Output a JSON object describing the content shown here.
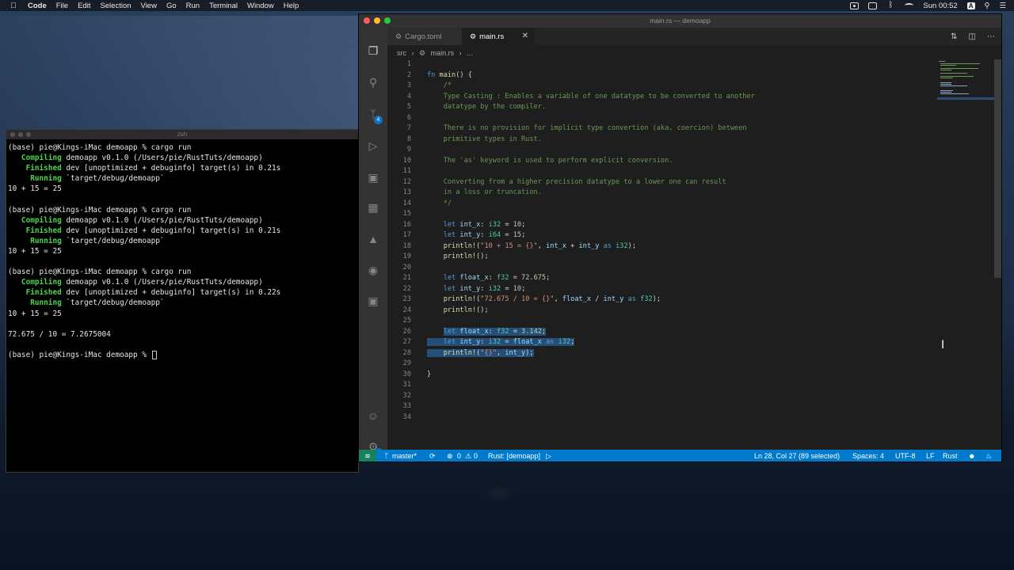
{
  "menubar": {
    "app_name": "Code",
    "items": [
      "File",
      "Edit",
      "Selection",
      "View",
      "Go",
      "Run",
      "Terminal",
      "Window",
      "Help"
    ],
    "clock": "Sun 00:52",
    "input_source": "A"
  },
  "terminal": {
    "title": "zsh",
    "lines": [
      [
        {
          "t": "(base) pie@Kings-iMac demoapp % cargo run"
        }
      ],
      [
        {
          "t": "   Compiling",
          "c": "g"
        },
        {
          "t": " demoapp v0.1.0 (/Users/pie/RustTuts/demoapp)"
        }
      ],
      [
        {
          "t": "    Finished",
          "c": "g"
        },
        {
          "t": " dev [unoptimized + debuginfo] target(s) in 0.21s"
        }
      ],
      [
        {
          "t": "     Running",
          "c": "g"
        },
        {
          "t": " `target/debug/demoapp`"
        }
      ],
      [
        {
          "t": "10 + 15 = 25"
        }
      ],
      [
        {
          "t": ""
        }
      ],
      [
        {
          "t": "(base) pie@Kings-iMac demoapp % cargo run"
        }
      ],
      [
        {
          "t": "   Compiling",
          "c": "g"
        },
        {
          "t": " demoapp v0.1.0 (/Users/pie/RustTuts/demoapp)"
        }
      ],
      [
        {
          "t": "    Finished",
          "c": "g"
        },
        {
          "t": " dev [unoptimized + debuginfo] target(s) in 0.21s"
        }
      ],
      [
        {
          "t": "     Running",
          "c": "g"
        },
        {
          "t": " `target/debug/demoapp`"
        }
      ],
      [
        {
          "t": "10 + 15 = 25"
        }
      ],
      [
        {
          "t": ""
        }
      ],
      [
        {
          "t": "(base) pie@Kings-iMac demoapp % cargo run"
        }
      ],
      [
        {
          "t": "   Compiling",
          "c": "g"
        },
        {
          "t": " demoapp v0.1.0 (/Users/pie/RustTuts/demoapp)"
        }
      ],
      [
        {
          "t": "    Finished",
          "c": "g"
        },
        {
          "t": " dev [unoptimized + debuginfo] target(s) in 0.22s"
        }
      ],
      [
        {
          "t": "     Running",
          "c": "g"
        },
        {
          "t": " `target/debug/demoapp`"
        }
      ],
      [
        {
          "t": "10 + 15 = 25"
        }
      ],
      [
        {
          "t": ""
        }
      ],
      [
        {
          "t": "72.675 / 10 = 7.2675004"
        }
      ],
      [
        {
          "t": ""
        }
      ],
      [
        {
          "t": "(base) pie@Kings-iMac demoapp % "
        }
      ]
    ]
  },
  "vscode": {
    "window_title": "main.rs — demoapp",
    "tabs": [
      {
        "label": "Cargo.toml",
        "active": false
      },
      {
        "label": "main.rs",
        "active": true
      }
    ],
    "breadcrumb": [
      "src",
      "main.rs",
      "..."
    ],
    "activity_badges": {
      "source_control": "4",
      "settings": "1"
    },
    "code_lines": [
      [],
      [
        {
          "t": "fn ",
          "c": "kw"
        },
        {
          "t": "main",
          "c": "fn"
        },
        {
          "t": "() {"
        }
      ],
      [
        {
          "t": "    "
        },
        {
          "t": "/*",
          "c": "cm"
        }
      ],
      [
        {
          "t": "    Type Casting : Enables a variable of one datatype to be converted to another",
          "c": "cm"
        }
      ],
      [
        {
          "t": "    datatype by the compiler.",
          "c": "cm"
        }
      ],
      [],
      [
        {
          "t": "    There is no provision for implicit type convertion (aka, coercion) between",
          "c": "cm"
        }
      ],
      [
        {
          "t": "    primitive types in Rust.",
          "c": "cm"
        }
      ],
      [],
      [
        {
          "t": "    The 'as' keyword is used to perform explicit conversion.",
          "c": "cm"
        }
      ],
      [],
      [
        {
          "t": "    Converting from a higher precision datatype to a lower one can result",
          "c": "cm"
        }
      ],
      [
        {
          "t": "    in a loss or truncation.",
          "c": "cm"
        }
      ],
      [
        {
          "t": "    */",
          "c": "cm"
        }
      ],
      [],
      [
        {
          "t": "    "
        },
        {
          "t": "let ",
          "c": "kw"
        },
        {
          "t": "int_x",
          "c": "var"
        },
        {
          "t": ": "
        },
        {
          "t": "i32",
          "c": "ty"
        },
        {
          "t": " = "
        },
        {
          "t": "10",
          "c": "num"
        },
        {
          "t": ";"
        }
      ],
      [
        {
          "t": "    "
        },
        {
          "t": "let ",
          "c": "kw"
        },
        {
          "t": "int_y",
          "c": "var"
        },
        {
          "t": ": "
        },
        {
          "t": "i64",
          "c": "ty"
        },
        {
          "t": " = "
        },
        {
          "t": "15",
          "c": "num"
        },
        {
          "t": ";"
        }
      ],
      [
        {
          "t": "    "
        },
        {
          "t": "println!",
          "c": "mac"
        },
        {
          "t": "("
        },
        {
          "t": "\"10 + 15 = {}\"",
          "c": "str"
        },
        {
          "t": ", "
        },
        {
          "t": "int_x",
          "c": "var"
        },
        {
          "t": " + "
        },
        {
          "t": "int_y",
          "c": "var"
        },
        {
          "t": " "
        },
        {
          "t": "as",
          "c": "kw"
        },
        {
          "t": " "
        },
        {
          "t": "i32",
          "c": "ty"
        },
        {
          "t": ");"
        }
      ],
      [
        {
          "t": "    "
        },
        {
          "t": "println!",
          "c": "mac"
        },
        {
          "t": "();"
        }
      ],
      [],
      [
        {
          "t": "    "
        },
        {
          "t": "let ",
          "c": "kw"
        },
        {
          "t": "float_x",
          "c": "var"
        },
        {
          "t": ": "
        },
        {
          "t": "f32",
          "c": "ty"
        },
        {
          "t": " = "
        },
        {
          "t": "72.675",
          "c": "num"
        },
        {
          "t": ";"
        }
      ],
      [
        {
          "t": "    "
        },
        {
          "t": "let ",
          "c": "kw"
        },
        {
          "t": "int_y",
          "c": "var"
        },
        {
          "t": ": "
        },
        {
          "t": "i32",
          "c": "ty"
        },
        {
          "t": " = "
        },
        {
          "t": "10",
          "c": "num"
        },
        {
          "t": ";"
        }
      ],
      [
        {
          "t": "    "
        },
        {
          "t": "println!",
          "c": "mac"
        },
        {
          "t": "("
        },
        {
          "t": "\"72.675 / 10 = {}\"",
          "c": "str"
        },
        {
          "t": ", "
        },
        {
          "t": "float_x",
          "c": "var"
        },
        {
          "t": " / "
        },
        {
          "t": "int_y",
          "c": "var"
        },
        {
          "t": " "
        },
        {
          "t": "as",
          "c": "kw"
        },
        {
          "t": " "
        },
        {
          "t": "f32",
          "c": "ty"
        },
        {
          "t": ");"
        }
      ],
      [
        {
          "t": "    "
        },
        {
          "t": "println!",
          "c": "mac"
        },
        {
          "t": "();"
        }
      ],
      [],
      [
        {
          "t": "    "
        },
        {
          "t": "let ",
          "c": "kw sel"
        },
        {
          "t": "float_x",
          "c": "var sel"
        },
        {
          "t": ": ",
          "c": "sel"
        },
        {
          "t": "f32",
          "c": "ty sel"
        },
        {
          "t": " = ",
          "c": "sel"
        },
        {
          "t": "3.142",
          "c": "num sel"
        },
        {
          "t": ";",
          "c": "sel"
        }
      ],
      [
        {
          "t": "    ",
          "c": "sel"
        },
        {
          "t": "let ",
          "c": "kw sel"
        },
        {
          "t": "int_y",
          "c": "var sel"
        },
        {
          "t": ": ",
          "c": "sel"
        },
        {
          "t": "i32",
          "c": "ty sel"
        },
        {
          "t": " = ",
          "c": "sel"
        },
        {
          "t": "float_x",
          "c": "var sel"
        },
        {
          "t": " ",
          "c": "sel"
        },
        {
          "t": "as",
          "c": "kw sel"
        },
        {
          "t": " ",
          "c": "sel"
        },
        {
          "t": "i32",
          "c": "ty sel"
        },
        {
          "t": ";",
          "c": "sel"
        }
      ],
      [
        {
          "t": "    ",
          "c": "sel"
        },
        {
          "t": "println!",
          "c": "mac sel"
        },
        {
          "t": "(",
          "c": "sel"
        },
        {
          "t": "\"{}\"",
          "c": "str sel"
        },
        {
          "t": ", ",
          "c": "sel"
        },
        {
          "t": "int_y",
          "c": "var sel"
        },
        {
          "t": ");",
          "c": "sel"
        }
      ],
      [],
      [
        {
          "t": "}"
        }
      ],
      [],
      [],
      [],
      []
    ],
    "status": {
      "branch": "master*",
      "errors": "0",
      "warnings": "0",
      "run_target": "Rust: [demoapp]",
      "cursor": "Ln 28, Col 27 (89 selected)",
      "spaces": "Spaces: 4",
      "encoding": "UTF-8",
      "eol": "LF",
      "language": "Rust"
    }
  }
}
